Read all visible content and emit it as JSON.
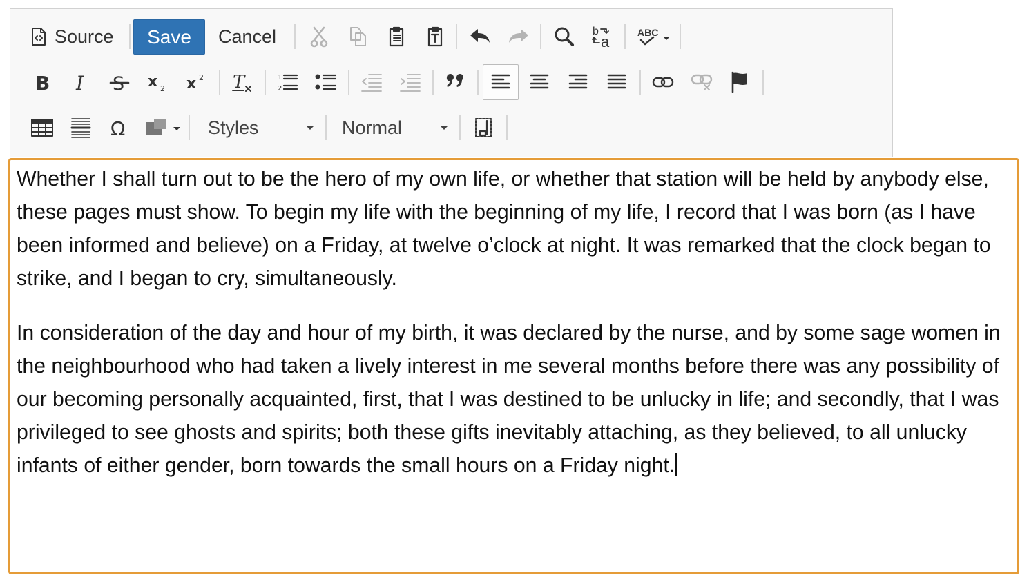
{
  "toolbar": {
    "source_label": "Source",
    "save_label": "Save",
    "cancel_label": "Cancel",
    "styles_label": "Styles",
    "format_label": "Normal",
    "icons": [
      "document-source-icon",
      "cut-icon",
      "copy-icon",
      "paste-icon",
      "paste-text-icon",
      "undo-icon",
      "redo-icon",
      "find-icon",
      "replace-icon",
      "spellcheck-icon",
      "bold-icon",
      "italic-icon",
      "strikethrough-icon",
      "subscript-icon",
      "superscript-icon",
      "remove-format-icon",
      "numbered-list-icon",
      "bulleted-list-icon",
      "decrease-indent-icon",
      "increase-indent-icon",
      "blockquote-icon",
      "align-left-icon",
      "align-center-icon",
      "align-right-icon",
      "justify-icon",
      "link-icon",
      "unlink-icon",
      "anchor-flag-icon",
      "table-icon",
      "horizontal-line-icon",
      "special-char-icon",
      "image-icon",
      "show-blocks-icon"
    ],
    "accent_save": "#2f73b4"
  },
  "editor": {
    "border_color": "#e59c38",
    "paragraphs": [
      "Whether I shall turn out to be the hero of my own life, or whether that station will be held by anybody else, these pages must show. To begin my life with the beginning of my life, I record that I was born (as I have been informed and believe) on a Friday, at twelve o’clock at night. It was remarked that the clock began to strike, and I began to cry, simultaneously.",
      "In consideration of the day and hour of my birth, it was declared by the nurse, and by some sage women in the neighbourhood who had taken a lively interest in me several months before there was any possibility of our becoming personally acquainted, first, that I was destined to be unlucky in life; and secondly, that I was privileged to see ghosts and spirits; both these gifts inevitably attaching, as they believed, to all unlucky infants of either gender, born towards the small hours on a Friday night."
    ]
  }
}
